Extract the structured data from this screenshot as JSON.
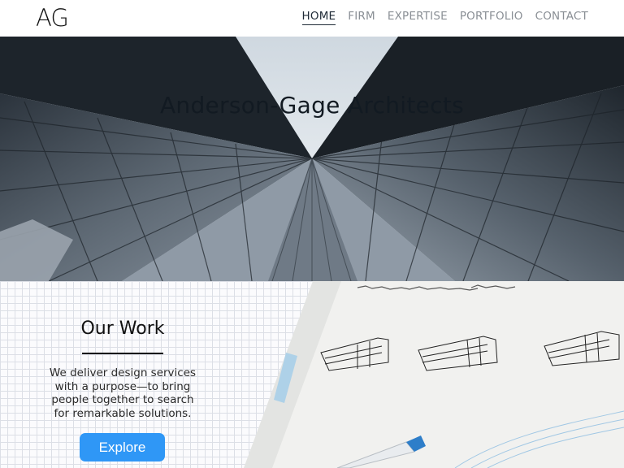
{
  "header": {
    "logo_text": "AG",
    "nav": [
      {
        "label": "HOME",
        "active": true
      },
      {
        "label": "FIRM",
        "active": false
      },
      {
        "label": "EXPERTISE",
        "active": false
      },
      {
        "label": "PORTFOLIO",
        "active": false
      },
      {
        "label": "CONTACT",
        "active": false
      }
    ]
  },
  "hero": {
    "title": "Anderson-Gage Architects"
  },
  "work": {
    "title": "Our Work",
    "description": "We deliver design services with a purpose—to bring people together to search for remarkable solutions.",
    "button_label": "Explore"
  },
  "colors": {
    "accent_button": "#2f97f6",
    "nav_active": "#1f2a36",
    "nav_inactive": "#8a8f95"
  }
}
